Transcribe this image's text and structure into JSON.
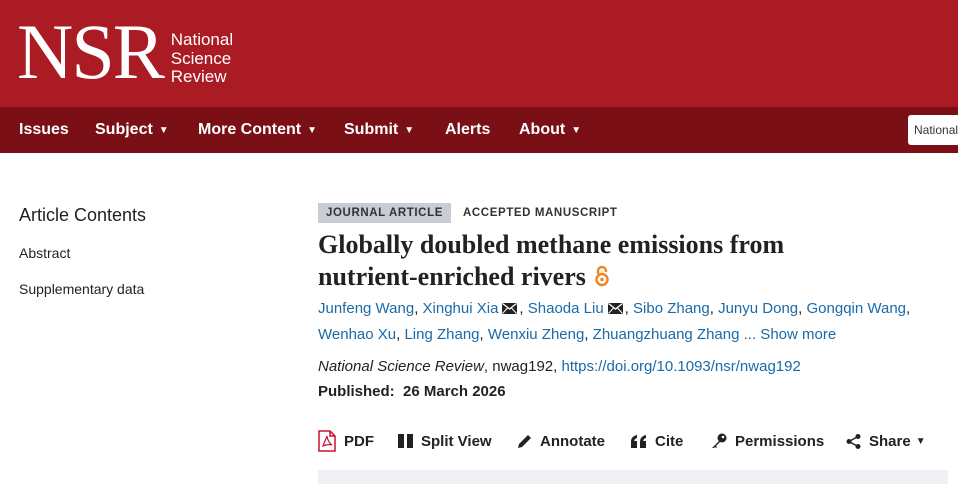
{
  "header": {
    "logo_big": "NSR",
    "logo_small_1": "National",
    "logo_small_2": "Science",
    "logo_small_3": "Review",
    "brand_color": "#ab1b24",
    "nav_color": "#7a0f16"
  },
  "nav": {
    "items": [
      {
        "label": "Issues"
      },
      {
        "label": "Subject"
      },
      {
        "label": "More Content"
      },
      {
        "label": "Submit"
      },
      {
        "label": "Alerts"
      },
      {
        "label": "About"
      }
    ],
    "search_value": "National"
  },
  "sidebar": {
    "title": "Article Contents",
    "links": [
      {
        "label": "Abstract"
      },
      {
        "label": "Supplementary data"
      }
    ]
  },
  "article": {
    "type_badge": "JOURNAL ARTICLE",
    "status_badge": "ACCEPTED MANUSCRIPT",
    "title_line1": "Globally doubled methane emissions from",
    "title_line2": "nutrient-enriched rivers",
    "open_access_icon": "open-access-icon",
    "authors": [
      "Junfeng Wang",
      "Xinghui Xia",
      "Shaoda Liu",
      "Sibo Zhang",
      "Junyu Dong",
      "Gongqin Wang",
      "Wenhao Xu",
      "Ling Zhang",
      "Wenxiu Zheng",
      "Zhuangzhuang Zhang"
    ],
    "show_more": "... Show more",
    "journal": "National Science Review",
    "article_id": ", nwag192, ",
    "doi": "https://doi.org/10.1093/nsr/nwag192",
    "published_label": "Published:",
    "published_date": "26 March 2026"
  },
  "toolbar": {
    "pdf": "PDF",
    "split_view": "Split View",
    "annotate": "Annotate",
    "cite": "Cite",
    "permissions": "Permissions",
    "share": "Share"
  }
}
